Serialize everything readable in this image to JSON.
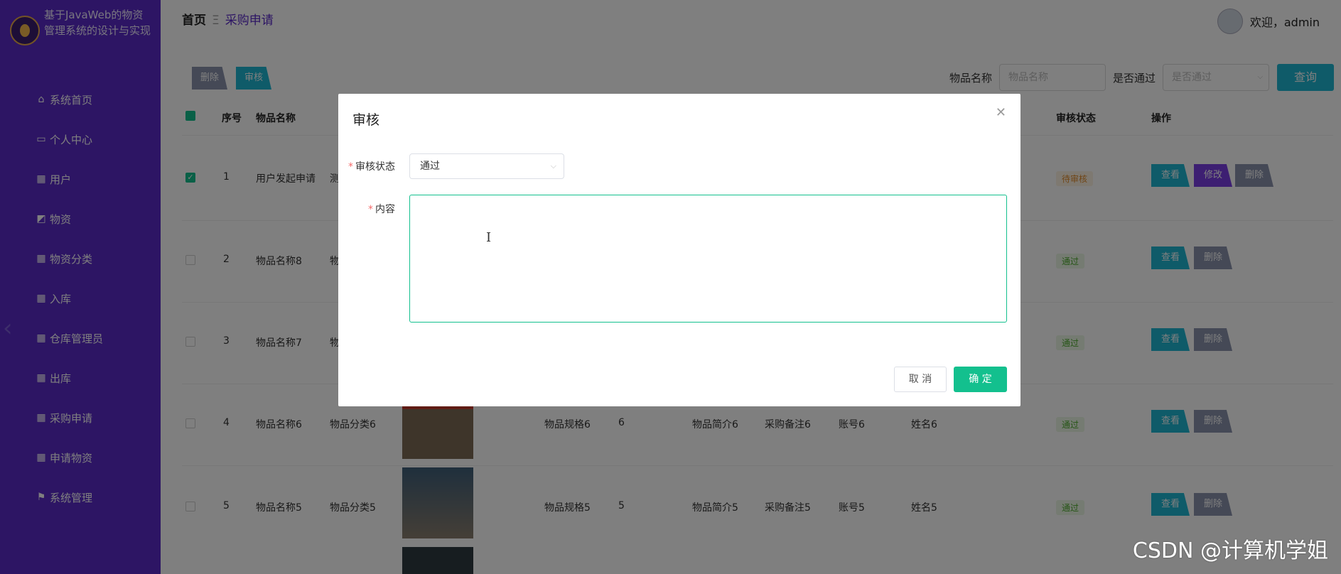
{
  "sidebar": {
    "brand": "基于JavaWeb的物资管理系统的设计与实现",
    "items": [
      {
        "label": "系统首页",
        "icon": "⌂"
      },
      {
        "label": "个人中心",
        "icon": "▭"
      },
      {
        "label": "用户",
        "icon": "▦"
      },
      {
        "label": "物资",
        "icon": "◩"
      },
      {
        "label": "物资分类",
        "icon": "▦"
      },
      {
        "label": "入库",
        "icon": "▦"
      },
      {
        "label": "仓库管理员",
        "icon": "▦"
      },
      {
        "label": "出库",
        "icon": "▦"
      },
      {
        "label": "采购申请",
        "icon": "▦"
      },
      {
        "label": "申请物资",
        "icon": "▦"
      },
      {
        "label": "系统管理",
        "icon": "⚑"
      }
    ]
  },
  "header": {
    "home": "首页",
    "current": "采购申请",
    "welcome": "欢迎，admin"
  },
  "toolbar": {
    "delete_label": "删除",
    "audit_label": "审核",
    "name_label": "物品名称",
    "name_placeholder": "物品名称",
    "pass_label": "是否通过",
    "pass_placeholder": "是否通过",
    "query_label": "查询"
  },
  "table": {
    "headers": {
      "index": "序号",
      "name": "物品名称",
      "status": "审核状态",
      "action": "操作"
    },
    "rows": [
      {
        "index": "1",
        "name": "用户发起申请",
        "category": "测",
        "status": "待审核",
        "checked": true,
        "actions": [
          "查看",
          "修改",
          "删除"
        ]
      },
      {
        "index": "2",
        "name": "物品名称8",
        "category": "物",
        "status": "通过",
        "checked": false,
        "actions": [
          "查看",
          "删除"
        ]
      },
      {
        "index": "3",
        "name": "物品名称7",
        "category": "物",
        "status": "通过",
        "checked": false,
        "actions": [
          "查看",
          "删除"
        ]
      },
      {
        "index": "4",
        "name": "物品名称6",
        "category": "物品分类6",
        "spec": "物品规格6",
        "qty": "6",
        "intro": "物品简介6",
        "remark": "采购备注6",
        "account": "账号6",
        "person": "姓名6",
        "status": "通过",
        "checked": false,
        "actions": [
          "查看",
          "删除"
        ]
      },
      {
        "index": "5",
        "name": "物品名称5",
        "category": "物品分类5",
        "spec": "物品规格5",
        "qty": "5",
        "intro": "物品简介5",
        "remark": "采购备注5",
        "account": "账号5",
        "person": "姓名5",
        "status": "通过",
        "checked": false,
        "actions": [
          "查看",
          "删除"
        ]
      }
    ]
  },
  "dialog": {
    "title": "审核",
    "status_label": "审核状态",
    "status_value": "通过",
    "content_label": "内容",
    "content_value": "",
    "cancel_label": "取 消",
    "ok_label": "确 定"
  },
  "watermark": "CSDN @计算机学姐",
  "colors": {
    "sidebar": "#5b2bc9",
    "primary": "#13c08e",
    "query": "#1fb6d3",
    "view_button": "#1fb6d3",
    "edit_button": "#7b3fe4",
    "delete_button": "#8a93ad"
  }
}
